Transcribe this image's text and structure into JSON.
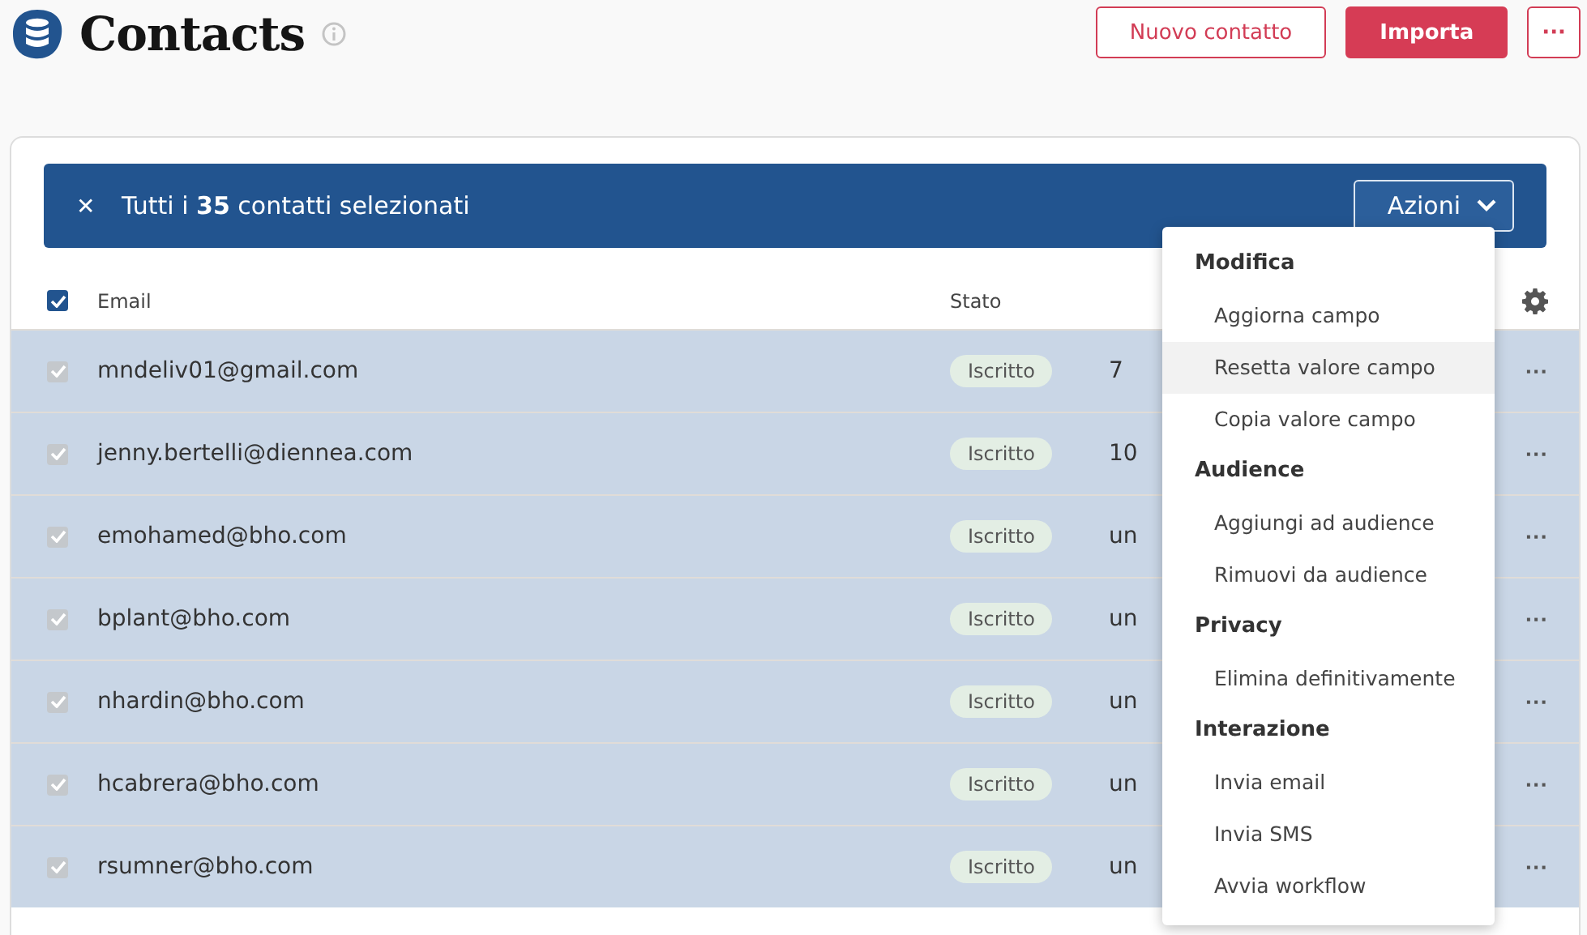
{
  "header": {
    "title": "Contacts",
    "buttons": [
      {
        "label": "Nuovo contatto",
        "kind": "outline"
      },
      {
        "label": "Importa",
        "kind": "primary"
      },
      {
        "label": "···",
        "kind": "more"
      }
    ]
  },
  "selection_banner": {
    "close": "✕",
    "text": "Tutti i **35** contatti selezionati",
    "actions_button": "Azioni"
  },
  "table": {
    "all_checked": true,
    "columns": [
      "Email",
      "Stato"
    ],
    "rows": [
      {
        "checked": true,
        "email": "mndeliv01@gmail.com",
        "status": "Iscritto",
        "column_3": "7",
        "more": "···"
      },
      {
        "checked": true,
        "email": "jenny.bertelli@diennea.com",
        "status": "Iscritto",
        "column_3": "10",
        "more": "···"
      },
      {
        "checked": true,
        "email": "emohamed@bho.com",
        "status": "Iscritto",
        "column_3": "un",
        "more": "···"
      },
      {
        "checked": true,
        "email": "bplant@bho.com",
        "status": "Iscritto",
        "column_3": "un",
        "more": "···"
      },
      {
        "checked": true,
        "email": "nhardin@bho.com",
        "status": "Iscritto",
        "column_3": "un",
        "more": "···"
      },
      {
        "checked": true,
        "email": "hcabrera@bho.com",
        "status": "Iscritto",
        "column_3": "un",
        "more": "···"
      },
      {
        "checked": true,
        "email": "rsumner@bho.com",
        "status": "Iscritto",
        "column_3": "un",
        "more": "···"
      }
    ]
  },
  "actions_menu": {
    "items": [
      {
        "kind": "heading",
        "label": "Modifica"
      },
      {
        "kind": "item",
        "label": "Aggiorna campo",
        "selected": false
      },
      {
        "kind": "item",
        "label": "Resetta valore campo",
        "selected": true
      },
      {
        "kind": "item",
        "label": "Copia valore campo",
        "selected": false
      },
      {
        "kind": "heading",
        "label": "Audience"
      },
      {
        "kind": "item",
        "label": "Aggiungi ad audience",
        "selected": false
      },
      {
        "kind": "item",
        "label": "Rimuovi da audience",
        "selected": false
      },
      {
        "kind": "heading",
        "label": "Privacy"
      },
      {
        "kind": "item",
        "label": "Elimina definitivamente",
        "selected": false
      },
      {
        "kind": "heading",
        "label": "Interazione"
      },
      {
        "kind": "item",
        "label": "Invia email",
        "selected": false
      },
      {
        "kind": "item",
        "label": "Invia SMS",
        "selected": false
      },
      {
        "kind": "item",
        "label": "Avvia workflow",
        "selected": false
      }
    ]
  }
}
